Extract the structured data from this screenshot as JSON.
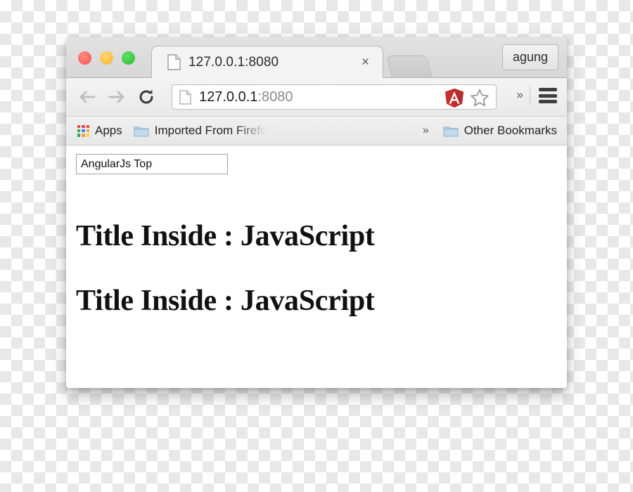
{
  "window": {
    "traffic_lights": [
      {
        "name": "close",
        "color": "#f4544f"
      },
      {
        "name": "minimize",
        "color": "#f5b32b"
      },
      {
        "name": "zoom",
        "color": "#28bf34"
      }
    ]
  },
  "tabstrip": {
    "tab": {
      "title": "127.0.0.1:8080",
      "favicon": "page-icon",
      "close_label": "×"
    },
    "new_tab_label": "",
    "profile_label": "agung"
  },
  "toolbar": {
    "back_label": "←",
    "forward_label": "→",
    "reload_label": "↻",
    "omnibox": {
      "icon": "page-icon",
      "host": "127.0.0.1",
      "port": ":8080",
      "extension_icon": "angularjs-icon",
      "bookmark_icon": "star-icon"
    },
    "overflow_label": "»",
    "menu_label": "hamburger-icon"
  },
  "bookmarks": {
    "apps_label": "Apps",
    "items": [
      {
        "label": "Imported From Firefo",
        "icon": "folder-icon",
        "truncated": true
      }
    ],
    "overflow_label": "»",
    "other_label": "Other Bookmarks"
  },
  "page": {
    "input_value": "AngularJs Top",
    "input_placeholder": "",
    "heading_1": "Title Inside : JavaScript",
    "heading_2": "Title Inside : JavaScript"
  },
  "colors": {
    "angular_red": "#c3312f",
    "chrome_chrome": "#d7d7d7",
    "link_grey": "#8a8a8a"
  }
}
